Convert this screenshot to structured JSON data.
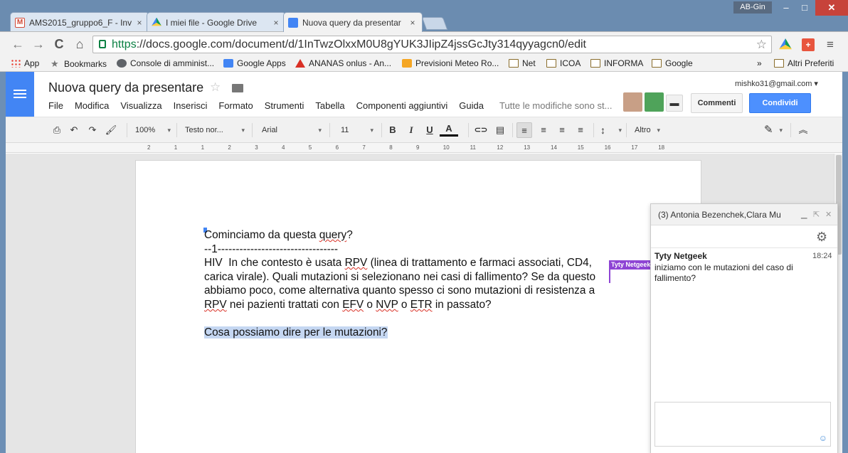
{
  "window": {
    "user": "AB-Gin",
    "minimize": "‒",
    "maximize": "□",
    "close": "✕"
  },
  "tabs": [
    {
      "title": "AMS2015_gruppo6_F - Inv",
      "icon": "gmail-icon",
      "close": "×"
    },
    {
      "title": "I miei file - Google Drive",
      "icon": "drive-icon",
      "close": "×"
    },
    {
      "title": "Nuova query da presentar",
      "icon": "docs-icon",
      "close": "×",
      "active": true
    }
  ],
  "browser": {
    "url_scheme": "https",
    "url_rest": "://docs.google.com/document/d/1InTwzOlxxM0U8gYUK3JIipZ4jssGcJty314qyyagcn0/edit",
    "back": "←",
    "forward": "→",
    "reload": "C",
    "home": "⌂",
    "star": "☆",
    "menu": "≡",
    "plus": "+"
  },
  "bookmarks": [
    {
      "label": "App",
      "icon": "apps-icon"
    },
    {
      "label": "Bookmarks",
      "icon": "star-icon"
    },
    {
      "label": "Console di amminist...",
      "icon": "console-icon"
    },
    {
      "label": "Google Apps",
      "icon": "google-apps-icon"
    },
    {
      "label": "ANANAS onlus - An...",
      "icon": "ananas-icon"
    },
    {
      "label": "Previsioni Meteo Ro...",
      "icon": "meteo-icon"
    },
    {
      "label": "Net",
      "icon": "folder-icon"
    },
    {
      "label": "ICOA",
      "icon": "folder-icon"
    },
    {
      "label": "INFORMA",
      "icon": "folder-icon"
    },
    {
      "label": "Google",
      "icon": "folder-icon"
    }
  ],
  "bookmarks_more": "»",
  "bookmarks_other": "Altri Preferiti",
  "doc": {
    "title": "Nuova query da presentare",
    "star": "☆",
    "account": "mishko31@gmail.com ▾",
    "menus": [
      "File",
      "Modifica",
      "Visualizza",
      "Inserisci",
      "Formato",
      "Strumenti",
      "Tabella",
      "Componenti aggiuntivi",
      "Guida"
    ],
    "save_status": "Tutte le modifiche sono st...",
    "comments_button": "Commenti",
    "share_button": "Condividi",
    "chat_icon": "▬"
  },
  "toolbar": {
    "print": "⎙",
    "undo": "↶",
    "redo": "↷",
    "paint": "🖌",
    "zoom": "100%",
    "style": "Testo nor...",
    "font": "Arial",
    "size": "11",
    "bold": "B",
    "italic": "I",
    "underline": "U",
    "text_color": "A",
    "link": "⊂⊃",
    "comment": "▤",
    "align_left": "≡",
    "align_center": "≡",
    "align_right": "≡",
    "justify": "≡",
    "line_spacing": "↕",
    "more": "Altro",
    "pen": "✎",
    "collapse": "︽"
  },
  "ruler": [
    "2",
    "1",
    "1",
    "2",
    "3",
    "4",
    "5",
    "6",
    "7",
    "8",
    "9",
    "10",
    "11",
    "12",
    "13",
    "14",
    "15",
    "16",
    "17",
    "18"
  ],
  "body": {
    "line1_a": "Cominciamo da questa ",
    "line1_b": "query",
    "line1_c": "?",
    "line2": "--1---------------------------------",
    "p3_a": "HIV  In che contesto è usata ",
    "p3_rpv": "RPV",
    "p3_b": " (linea di trattamento e farmaci associati, CD4, carica virale). Quali mutazioni si selezionano nei casi di fallimento? Se da questo abbiamo poco, come alternativa quanto spesso ci sono mutazioni di resistenza a ",
    "p3_rpv2": "RPV",
    "p3_c": " nei pazienti trattati con ",
    "p3_efv": "EFV",
    "p3_d": " o ",
    "p3_nvp": "NVP",
    "p3_e": " o ",
    "p3_etr": "ETR",
    "p3_f": " in passato?",
    "p4": "Cosa possiamo dire per le mutazioni?",
    "collaborator_flag": "Tyty Netgeek"
  },
  "chat": {
    "header": "(3) Antonia Bezenchek,Clara Mu",
    "minimize": "▁",
    "popout": "⇱",
    "close": "✕",
    "settings": "⚙",
    "author": "Tyty Netgeek",
    "time": "18:24",
    "message": "iniziamo con le mutazioni del caso di fallimento?",
    "emoji": "☺"
  }
}
